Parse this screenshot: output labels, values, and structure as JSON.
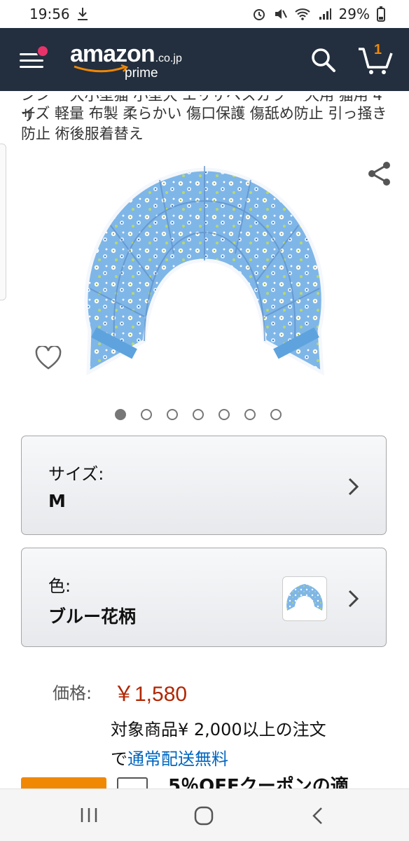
{
  "status_bar": {
    "time": "19:56",
    "battery": "29%"
  },
  "header": {
    "logo_text": "amazon",
    "logo_tld": ".co.jp",
    "logo_prime": "prime",
    "cart_count": "1",
    "accent_color": "#f08804",
    "bg_color": "#232f3e"
  },
  "product": {
    "title_line1_cut": "ンシー 大小型猫 小型犬 エリザベスカラー 犬用 猫用 4サ",
    "title": "イズ 軽量 布製 柔らかい 傷口保護 傷舐め防止 引っ掻き防止 術後服着替え",
    "image_dots_count": 7,
    "active_dot": 0
  },
  "variations": {
    "size_label": "サイズ:",
    "size_value": "M",
    "color_label": "色:",
    "color_value": "ブルー花柄"
  },
  "price": {
    "label": "価格:",
    "value": "￥1,580",
    "shipping_line1": "対象商品¥ 2,000以上の注文",
    "shipping_line2_prefix": "で",
    "shipping_link": "通常配送無料"
  },
  "coupon": {
    "text": "5％OFFクーポンの適"
  },
  "icons": {
    "menu": "menu-icon",
    "search": "search-icon",
    "cart": "cart-icon",
    "share": "share-icon",
    "wishlist": "heart-icon",
    "chevron": "chevron-right-icon"
  }
}
